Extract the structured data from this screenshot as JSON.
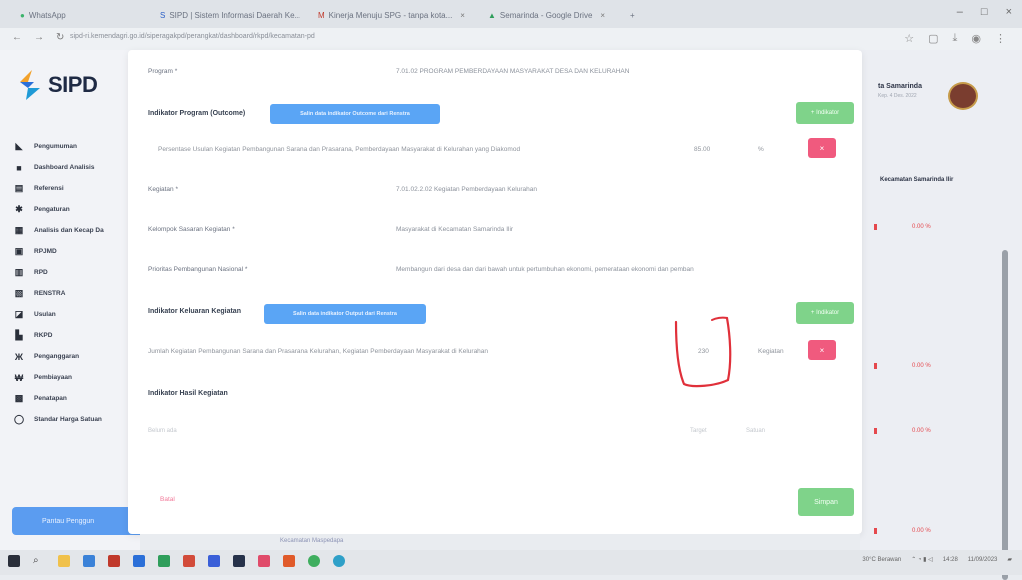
{
  "browser": {
    "tabs": [
      {
        "label": "WhatsApp",
        "icon": "whatsapp-icon"
      },
      {
        "label": "SIPD | Sistem Informasi Daerah Ke...",
        "icon": "sipd-icon"
      },
      {
        "label": "Kinerja Menuju SPG - tanpa kota...",
        "icon": "mail-icon"
      },
      {
        "label": "Semarinda - Google Drive",
        "icon": "drive-icon"
      }
    ],
    "url": "sipd-ri.kemendagri.go.id/siperagakpd/perangkat/dashboard/rkpd/kecamatan-pd"
  },
  "sidebar": {
    "logo_text": "SIPD",
    "items": [
      {
        "label": "Pengumuman",
        "icon": "megaphone-icon"
      },
      {
        "label": "Dashboard Analisis",
        "icon": "dashboard-icon"
      },
      {
        "label": "Referensi",
        "icon": "book-icon"
      },
      {
        "label": "Pengaturan",
        "icon": "gear-icon"
      },
      {
        "label": "Analisis dan Kecap Da",
        "icon": "chart-icon"
      },
      {
        "label": "RPJMD",
        "icon": "document-icon"
      },
      {
        "label": "RPD",
        "icon": "document-icon"
      },
      {
        "label": "RENSTRA",
        "icon": "folder-icon"
      },
      {
        "label": "Usulan",
        "icon": "inbox-icon"
      },
      {
        "label": "RKPD",
        "icon": "list-icon"
      },
      {
        "label": "Penganggaran",
        "icon": "scale-icon"
      },
      {
        "label": "Pembiayaan",
        "icon": "money-icon"
      },
      {
        "label": "Penatapan",
        "icon": "calendar-icon"
      },
      {
        "label": "Standar Harga Satuan",
        "icon": "tag-icon"
      }
    ],
    "bottom_button": "Pantau Penggun"
  },
  "right_panel": {
    "title": "ta Samarinda",
    "subtitle": "Kep. 4 Des. 2022",
    "header": "Kecamatan Samarinda Ilir",
    "percentages": [
      "0.00 %",
      "0.00 %",
      "0.00 %",
      "0.00 %"
    ]
  },
  "modal": {
    "program_label": "Program *",
    "program_value": "7.01.02 PROGRAM PEMBERDAYAAN MASYARAKAT DESA DAN KELURAHAN",
    "outcome_section": "Indikator Program (Outcome)",
    "outcome_button": "Salin data indikator Outcome dari Renstra",
    "add_indikator": "+ Indikator",
    "outcome_row": {
      "text": "Persentase Usulan Kegiatan Pembangunan Sarana dan Prasarana, Pemberdayaan Masyarakat di Kelurahan yang Diakomod",
      "value": "85.00",
      "unit": "%"
    },
    "kegiatan_label": "Kegiatan *",
    "kegiatan_value": "7.01.02.2.02 Kegiatan Pemberdayaan Kelurahan",
    "kelompok_label": "Kelompok Sasaran Kegiatan *",
    "kelompok_value": "Masyarakat di Kecamatan Samarinda Ilir",
    "prioritas_label": "Prioritas Pembangunan Nasional *",
    "prioritas_value": "Membangun dari desa dan dari bawah untuk pertumbuhan ekonomi, pemerataan ekonomi dan pemban",
    "keluaran_section": "Indikator Keluaran Kegiatan",
    "keluaran_button": "Salin data indikator Output dari Renstra",
    "keluaran_row": {
      "text": "Jumlah Kegiatan Pembangunan Sarana dan Prasarana Kelurahan, Kegiatan Pemberdayaan Masyarakat di Kelurahan",
      "value": "230",
      "unit": "Kegiatan"
    },
    "hasil_section": "Indikator Hasil Kegiatan",
    "hasil_placeholder": "Belum ada",
    "hasil_target": "Target",
    "hasil_satuan": "Satuan",
    "cancel_label": "Batal",
    "save_label": "Simpan",
    "remove_label": "×"
  },
  "bottom_strip_text": "Kecamatan Maspedapa",
  "taskbar": {
    "weather": "30°C Berawan",
    "time": "14:28",
    "date": "11/09/2023"
  },
  "annotation_color": "#e0303a"
}
